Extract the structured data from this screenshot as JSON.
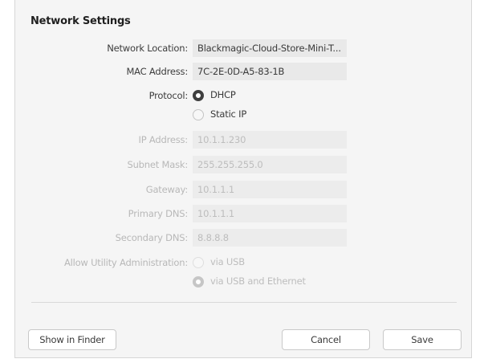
{
  "dialog": {
    "title": "Network Settings"
  },
  "fields": {
    "network_location": {
      "label": "Network Location:",
      "value": "Blackmagic-Cloud-Store-Mini-T..."
    },
    "mac_address": {
      "label": "MAC Address:",
      "value": "7C-2E-0D-A5-83-1B"
    },
    "ip_address": {
      "label": "IP Address:",
      "value": "10.1.1.230"
    },
    "subnet_mask": {
      "label": "Subnet Mask:",
      "value": "255.255.255.0"
    },
    "gateway": {
      "label": "Gateway:",
      "value": "10.1.1.1"
    },
    "primary_dns": {
      "label": "Primary DNS:",
      "value": "10.1.1.1"
    },
    "secondary_dns": {
      "label": "Secondary DNS:",
      "value": "8.8.8.8"
    }
  },
  "protocol": {
    "label": "Protocol:",
    "options": [
      "DHCP",
      "Static IP"
    ],
    "selected": "DHCP"
  },
  "utility_admin": {
    "label": "Allow Utility Administration:",
    "options": [
      "via USB",
      "via USB and Ethernet"
    ],
    "selected": "via USB and Ethernet"
  },
  "buttons": {
    "show_in_finder": "Show in Finder",
    "cancel": "Cancel",
    "save": "Save"
  },
  "colors": {
    "disabled_text": "#bdbdbd",
    "panel_background": "#f5f5f5"
  }
}
